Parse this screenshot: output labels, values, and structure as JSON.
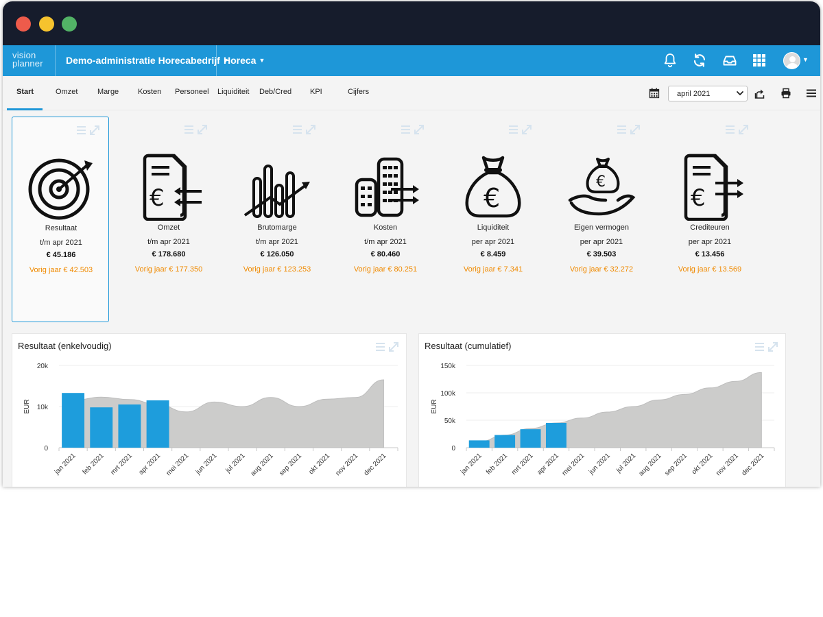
{
  "app": {
    "logo_top": "vision",
    "logo_bottom": "planner",
    "administration": "Demo-administratie Horecabedrijf",
    "sector": "Horeca"
  },
  "nav": {
    "tabs": [
      "Start",
      "Omzet",
      "Marge",
      "Kosten",
      "Personeel",
      "Liquiditeit",
      "Deb/Cred",
      "KPI",
      "Cijfers"
    ],
    "active_tab": "Start",
    "period": "april 2021"
  },
  "kpis": [
    {
      "icon": "target-icon",
      "title": "Resultaat",
      "period": "t/m apr 2021",
      "value": "€ 45.186",
      "prev": "Vorig jaar € 42.503",
      "selected": true
    },
    {
      "icon": "invoice-in-icon",
      "title": "Omzet",
      "period": "t/m apr 2021",
      "value": "€ 178.680",
      "prev": "Vorig jaar € 177.350"
    },
    {
      "icon": "bar-growth-icon",
      "title": "Brutomarge",
      "period": "t/m apr 2021",
      "value": "€ 126.050",
      "prev": "Vorig jaar € 123.253"
    },
    {
      "icon": "coins-out-icon",
      "title": "Kosten",
      "period": "t/m apr 2021",
      "value": "€ 80.460",
      "prev": "Vorig jaar € 80.251"
    },
    {
      "icon": "money-bag-icon",
      "title": "Liquiditeit",
      "period": "per  apr 2021",
      "value": "€ 8.459",
      "prev": "Vorig jaar € 7.341"
    },
    {
      "icon": "hand-money-bag-icon",
      "title": "Eigen vermogen",
      "period": "per  apr 2021",
      "value": "€ 39.503",
      "prev": "Vorig jaar € 32.272"
    },
    {
      "icon": "invoice-out-icon",
      "title": "Crediteuren",
      "period": "per  apr 2021",
      "value": "€ 13.456",
      "prev": "Vorig jaar € 13.569"
    }
  ],
  "colors": {
    "accent": "#1e97d8",
    "bar": "#1e9ddc",
    "area": "#cccccb",
    "prev_year_text": "#f08a00",
    "titlebar": "#161c2c"
  },
  "chart_data": [
    {
      "type": "bar",
      "title": "Resultaat (enkelvoudig)",
      "ylabel": "EUR",
      "categories": [
        "jan 2021",
        "feb 2021",
        "mrt 2021",
        "apr 2021",
        "mei 2021",
        "jun 2021",
        "jul 2021",
        "aug 2021",
        "sep 2021",
        "okt 2021",
        "nov 2021",
        "dec 2021"
      ],
      "yticks": [
        "0",
        "10k",
        "20k"
      ],
      "ylim": [
        0,
        20000
      ],
      "series": [
        {
          "type": "area",
          "values": [
            11500,
            12300,
            11700,
            10500,
            8700,
            11100,
            10000,
            12200,
            10000,
            11800,
            12200,
            16500
          ]
        },
        {
          "type": "bar",
          "values": [
            13300,
            9800,
            10500,
            11500
          ]
        }
      ]
    },
    {
      "type": "bar",
      "title": "Resultaat (cumulatief)",
      "ylabel": "EUR",
      "categories": [
        "jan 2021",
        "feb 2021",
        "mrt 2021",
        "apr 2021",
        "mei 2021",
        "jun 2021",
        "jul 2021",
        "aug 2021",
        "sep 2021",
        "okt 2021",
        "nov 2021",
        "dec 2021"
      ],
      "yticks": [
        "0",
        "50k",
        "100k",
        "150k"
      ],
      "ylim": [
        0,
        150000
      ],
      "series": [
        {
          "type": "area",
          "values": [
            11000,
            23000,
            35000,
            45000,
            54000,
            65000,
            75000,
            87000,
            97000,
            109000,
            121000,
            137000
          ]
        },
        {
          "type": "bar",
          "values": [
            13300,
            23100,
            33600,
            45100
          ]
        }
      ]
    }
  ]
}
